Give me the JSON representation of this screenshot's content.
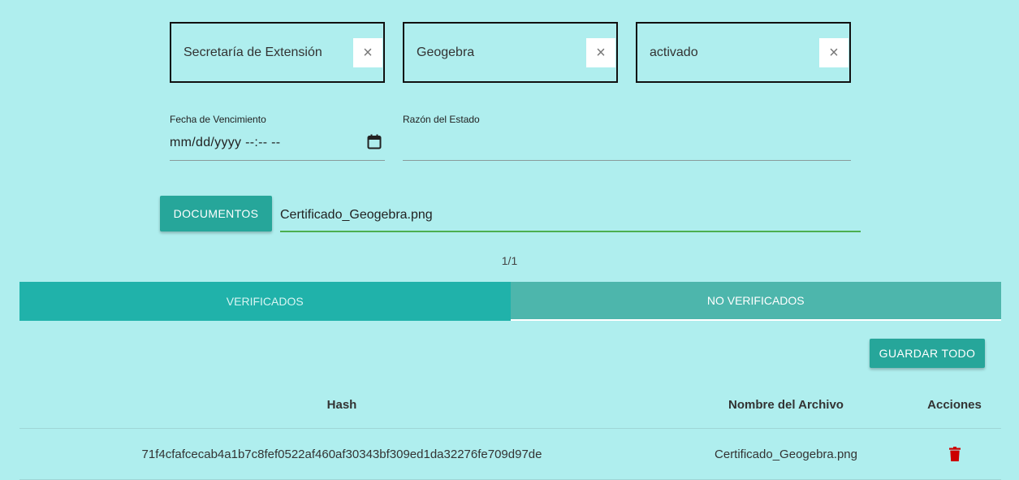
{
  "filters": [
    {
      "value": "Secretaría de Extensión",
      "clear": "×"
    },
    {
      "value": "Geogebra",
      "clear": "×"
    },
    {
      "value": "activado",
      "clear": "×"
    }
  ],
  "expiry": {
    "label": "Fecha de Vencimiento",
    "value": "mm/dd/yyyy --:-- --",
    "icon": "calendar-icon"
  },
  "reason": {
    "label": "Razón del Estado",
    "value": ""
  },
  "documents": {
    "button_label": "DOCUMENTOS",
    "file_name": "Certificado_Geogebra.png"
  },
  "pager": "1/1",
  "tabs": [
    {
      "label": "VERIFICADOS"
    },
    {
      "label": "NO VERIFICADOS"
    }
  ],
  "save_all_label": "GUARDAR TODO",
  "table": {
    "headers": [
      "Hash",
      "Nombre del Archivo",
      "Acciones"
    ],
    "rows": [
      {
        "hash": "71f4cfafcecab4a1b7c8fef0522af460af30343bf309ed1da32276fe709d97de",
        "file_name": "Certificado_Geogebra.png",
        "action_icon": "trash-icon"
      }
    ]
  },
  "colors": {
    "background": "#afeeee",
    "accent": "#26a69a",
    "tab_active": "#20b2aa",
    "tab_inactive": "#4db6ac",
    "delete": "#cc0000",
    "file_underline": "#4caf50"
  }
}
